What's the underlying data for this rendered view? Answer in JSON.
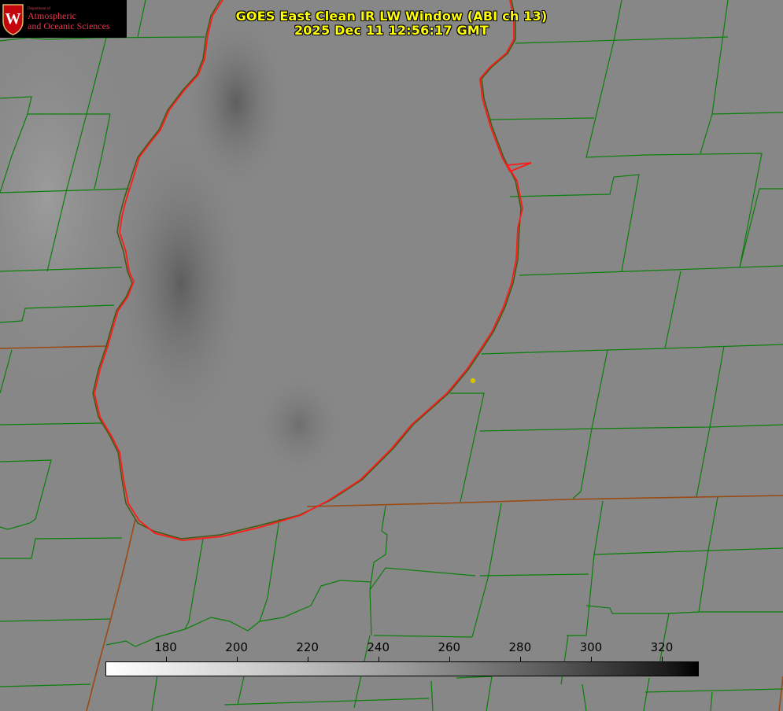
{
  "title": {
    "line1": "GOES East Clean IR LW Window (ABI ch 13)",
    "line2": "2025 Dec 11 12:56:17 GMT"
  },
  "logo": {
    "department": "Department of",
    "line1": "Atmospheric",
    "line2": "and Oceanic Sciences",
    "crest_letter": "W"
  },
  "colorbar": {
    "ticks": [
      180,
      200,
      220,
      240,
      260,
      280,
      300,
      320
    ],
    "range": [
      163,
      330
    ],
    "colors": {
      "low": "#ffffff",
      "high": "#000000"
    }
  },
  "colors": {
    "background": "#888888",
    "county_lines": "#008000",
    "state_lines": "#a04a10",
    "coastline": "#ff0000",
    "title": "#ffff00",
    "station_marker": "#d4c200"
  },
  "features": {
    "lake": "Lake Michigan (southern basin)",
    "station_marker": "yellow-dot"
  }
}
